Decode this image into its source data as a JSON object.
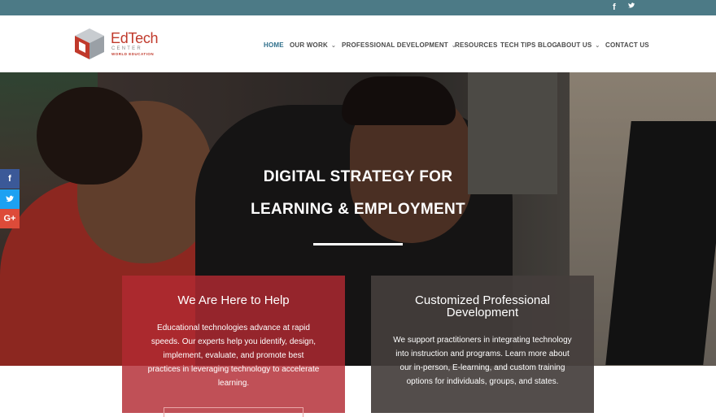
{
  "topbar": {
    "facebook": "f",
    "twitter": "t"
  },
  "logo": {
    "brand": "EdTech",
    "center": "CENTER",
    "org": "WORLD EDUCATION"
  },
  "nav": {
    "items": [
      {
        "label": "HOME"
      },
      {
        "label": "OUR WORK"
      },
      {
        "label": "PROFESSIONAL DEVELOPMENT"
      },
      {
        "label": "RESOURCES"
      },
      {
        "label": "TECH TIPS BLOG"
      },
      {
        "label": "ABOUT US"
      },
      {
        "label": "CONTACT US"
      }
    ]
  },
  "hero": {
    "line1": "DIGITAL STRATEGY FOR",
    "line2": "LEARNING & EMPLOYMENT"
  },
  "share": {
    "facebook": "f",
    "twitter": "t",
    "googleplus": "G+"
  },
  "cards": [
    {
      "title": "We Are Here to Help",
      "body": "Educational technologies advance at rapid speeds. Our experts help you identify, design, implement, evaluate, and promote best practices in leveraging technology to accelerate learning."
    },
    {
      "title": "Customized Professional Development",
      "body": "We support practitioners in integrating technology into instruction and programs. Learn more about our in-person, E-learning, and custom training options for individuals, groups, and states."
    }
  ],
  "colors": {
    "topbar": "#4c7a86",
    "accent_red": "#b22a32",
    "nav_active": "#2f6f8b",
    "card_grey": "#443e3c"
  }
}
